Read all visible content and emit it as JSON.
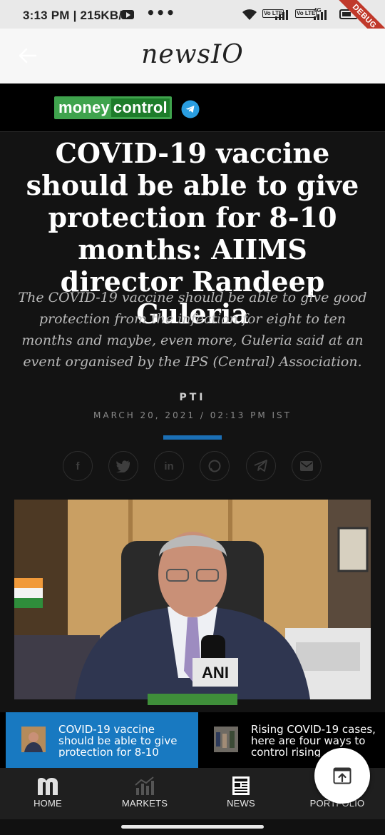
{
  "status_bar": {
    "left_text": "3:13 PM | 215KB/s",
    "dots": "•••",
    "volte_1": "Vo LTE",
    "volte_2": "Vo LTE",
    "network": "4G",
    "debug_ribbon": "DEBUG",
    "icons": [
      "youtube-icon",
      "wifi-icon",
      "signal-icon",
      "battery-icon"
    ]
  },
  "app_header": {
    "title": "newsIO",
    "back_icon": "arrow-left-icon"
  },
  "brand": {
    "logo_part1": "money",
    "logo_part2": "control",
    "telegram_icon": "telegram-icon",
    "logo_color": "#3fa34d"
  },
  "article": {
    "headline": "COVID-19 vaccine should be able to give protection for 8-10 months: AIIMS director Randeep Guleria",
    "summary": "The COVID-19 vaccine should be able to give good protection from the infection for eight to ten months and maybe, even more, Guleria said at an event organised by the IPS (Central) Association.",
    "author": "PTI",
    "date": "MARCH 20, 2021",
    "time": "02:13 PM IST",
    "separator": "/",
    "accent_color": "#1b6fb5",
    "share": [
      {
        "name": "facebook",
        "glyph": "f"
      },
      {
        "name": "twitter",
        "glyph": ""
      },
      {
        "name": "linkedin",
        "glyph": "in"
      },
      {
        "name": "whatsapp",
        "glyph": ""
      },
      {
        "name": "telegram",
        "glyph": ""
      },
      {
        "name": "email",
        "glyph": ""
      }
    ],
    "photo_badge": "ANI"
  },
  "related": [
    {
      "title": "COVID-19 vaccine should be able to give protection for 8-10",
      "active": true
    },
    {
      "title": "Rising COVID-19 cases, here are four ways to control rising",
      "active": false
    }
  ],
  "bottom_nav": [
    {
      "label": "HOME",
      "icon": "moneycontrol-m-icon"
    },
    {
      "label": "MARKETS",
      "icon": "chart-icon"
    },
    {
      "label": "NEWS",
      "icon": "newspaper-icon"
    },
    {
      "label": "PORTFOLIO",
      "icon": "portfolio-icon"
    }
  ],
  "fab": {
    "icon": "open-in-app-icon"
  }
}
